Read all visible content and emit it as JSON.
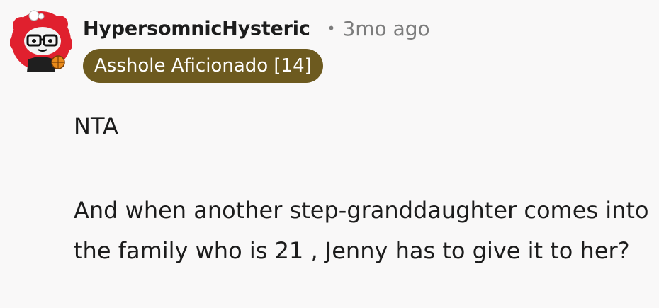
{
  "comment": {
    "author": {
      "username": "HypersomnicHysteric",
      "avatar_icon": "snoo-avatar-icon"
    },
    "separator": "•",
    "timestamp": "3mo ago",
    "flair": {
      "text": "Asshole Aficionado [14]",
      "color": "#6d5a1f"
    },
    "body": [
      "NTA",
      "And when another step-granddaughter comes into the family who is 21 , Jenny has to give it to her?"
    ]
  }
}
